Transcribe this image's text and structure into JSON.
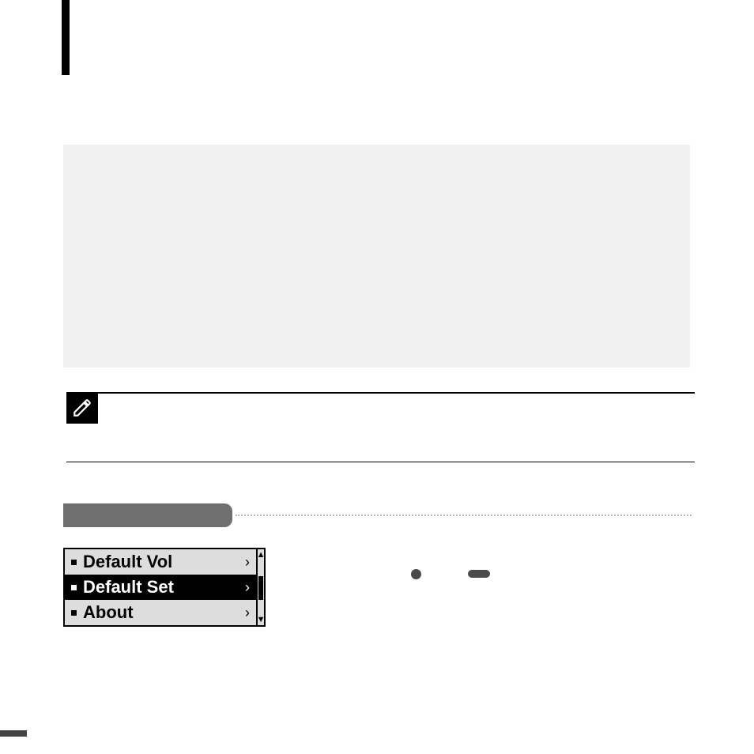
{
  "menu": {
    "items": [
      {
        "label": "Default Vol",
        "selected": false
      },
      {
        "label": "Default Set",
        "selected": true
      },
      {
        "label": "About",
        "selected": false
      }
    ]
  }
}
